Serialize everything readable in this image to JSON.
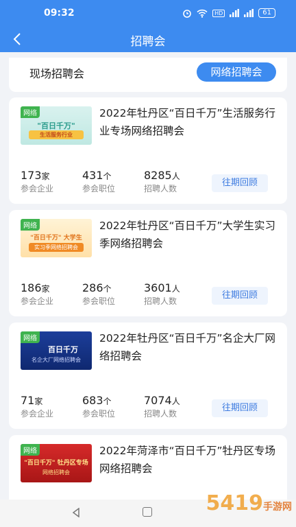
{
  "status_bar": {
    "time": "09:32",
    "hd_label": "HD",
    "battery": "61"
  },
  "header": {
    "title": "招聘会"
  },
  "tabs": [
    {
      "label": "现场招聘会",
      "active": false
    },
    {
      "label": "网络招聘会",
      "active": true
    }
  ],
  "stat_labels": {
    "companies": "参会企业",
    "positions": "参会职位",
    "people": "招聘人数"
  },
  "units": {
    "companies": "家",
    "positions": "个",
    "people": "人"
  },
  "cards": [
    {
      "badge": "网络",
      "thumb_title": "\"百日千万\"",
      "thumb_sub": "生活服务行业",
      "title": "2022年牡丹区“百日千万”生活服务行业专场网络招聘会",
      "companies": "173",
      "positions": "431",
      "people": "8285",
      "review_label": "往期回顾"
    },
    {
      "badge": "网络",
      "thumb_title": "\"百日千万\" 大学生",
      "thumb_sub": "实习季网络招聘会",
      "title": "2022年牡丹区“百日千万”大学生实习季网络招聘会",
      "companies": "186",
      "positions": "286",
      "people": "3601",
      "review_label": "往期回顾"
    },
    {
      "badge": "网络",
      "thumb_title": "百日千万",
      "thumb_sub": "名企大厂网络招聘会",
      "title": "2022年牡丹区“百日千万”名企大厂网络招聘会",
      "companies": "71",
      "positions": "683",
      "people": "7074",
      "review_label": "往期回顾"
    },
    {
      "badge": "网络",
      "thumb_title": "\"百日千万\" 牡丹区专场",
      "thumb_sub": "网络招聘会",
      "title": "2022年菏泽市“百日千万”牡丹区专场网络招聘会"
    }
  ],
  "watermark": {
    "main": "5419",
    "sub": "手游网"
  },
  "colors": {
    "primary": "#3d8bf0",
    "badge_green": "#3fb34f",
    "review_text": "#3d7be0"
  }
}
